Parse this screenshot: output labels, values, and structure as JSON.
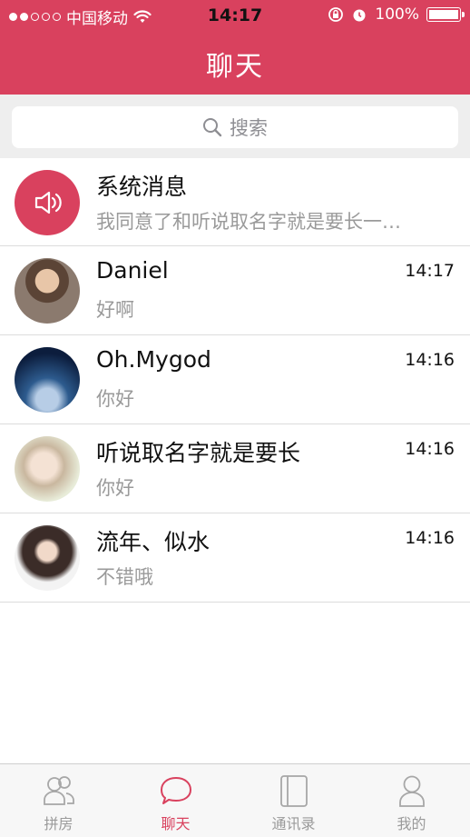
{
  "status": {
    "carrier": "中国移动",
    "time": "14:17",
    "battery": "100%",
    "signal_bars": 2,
    "signal_total": 5
  },
  "nav": {
    "title": "聊天"
  },
  "search": {
    "placeholder": "搜索"
  },
  "chats": [
    {
      "name": "系统消息",
      "preview": "我同意了和听说取名字就是要长一…",
      "time": "",
      "avatar": "speaker-icon"
    },
    {
      "name": "Daniel",
      "preview": "好啊",
      "time": "14:17",
      "avatar": "photo"
    },
    {
      "name": "Oh.Mygod",
      "preview": "你好",
      "time": "14:16",
      "avatar": "photo"
    },
    {
      "name": "听说取名字就是要长",
      "preview": "你好",
      "time": "14:16",
      "avatar": "photo"
    },
    {
      "name": "流年、似水",
      "preview": "不错哦",
      "time": "14:16",
      "avatar": "photo"
    }
  ],
  "tabs": [
    {
      "label": "拼房",
      "icon": "users-icon",
      "active": false
    },
    {
      "label": "聊天",
      "icon": "chat-bubble-icon",
      "active": true
    },
    {
      "label": "通讯录",
      "icon": "contacts-book-icon",
      "active": false
    },
    {
      "label": "我的",
      "icon": "profile-icon",
      "active": false
    }
  ],
  "colors": {
    "brand": "#D9415E",
    "background": "#ffffff",
    "search_bar_bg": "#eeeeee"
  }
}
